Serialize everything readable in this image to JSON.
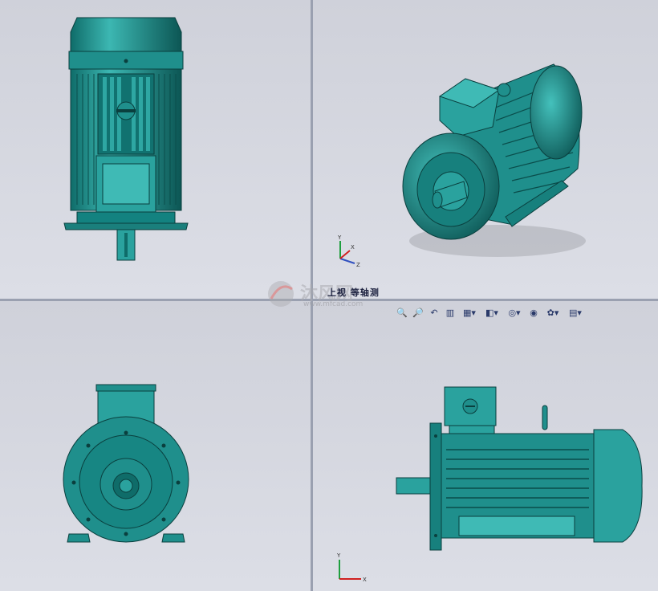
{
  "view_label": "上视 等轴测",
  "watermark": {
    "brand": "沐风网",
    "url": "www.mfcad.com"
  },
  "triad_labels": {
    "x": "X",
    "y": "Y",
    "z": "Z"
  },
  "toolbar": {
    "buttons": [
      {
        "icon": "zoom-to-fit-icon"
      },
      {
        "icon": "zoom-to-area-icon"
      },
      {
        "icon": "previous-view-icon"
      },
      {
        "icon": "section-view-icon"
      },
      {
        "icon": "view-orientation-icon",
        "dropdown": true
      },
      {
        "icon": "display-style-icon",
        "dropdown": true
      },
      {
        "icon": "hide-show-items-icon",
        "dropdown": true
      },
      {
        "icon": "edit-appearance-icon"
      },
      {
        "icon": "apply-scene-icon",
        "dropdown": true
      },
      {
        "icon": "view-settings-icon",
        "dropdown": true
      }
    ]
  },
  "colors": {
    "model": "#1f8f8c",
    "model_light": "#3fb5b0",
    "model_dark": "#0c5654",
    "background": "#d5d7df",
    "divider": "#9aa0b0"
  }
}
